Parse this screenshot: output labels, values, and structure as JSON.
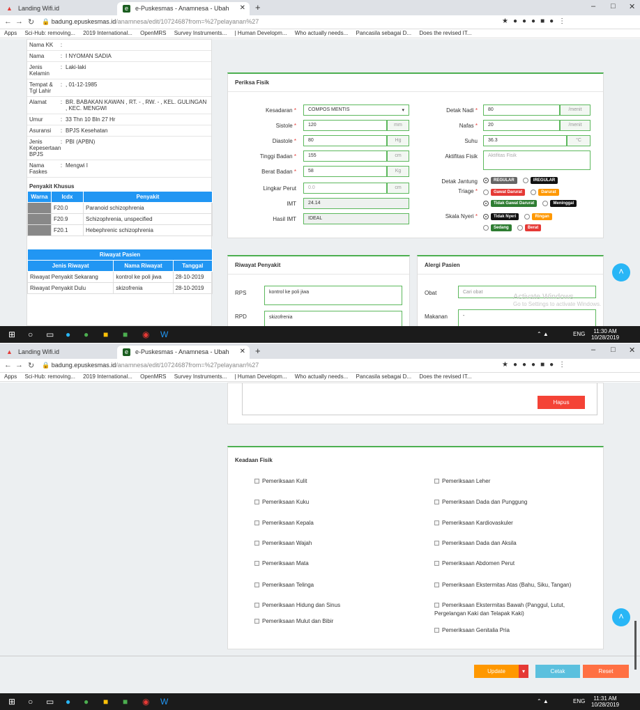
{
  "browser": {
    "tab1": "Landing Wifi.id",
    "tab2": "e-Puskesmas - Anamnesa - Ubah",
    "url_host": "badung.epuskesmas.id",
    "url_path": "/anamnesa/edit/10724687from=%27pelayanan%27",
    "bookmarks": [
      "Apps",
      "Sci-Hub: removing...",
      "2019 International...",
      "OpenMRS",
      "Survey Instruments...",
      "| Human Developm...",
      "Who actually needs...",
      "Pancasila sebagai D...",
      "Does the revised IT..."
    ]
  },
  "patient": {
    "rows": [
      {
        "k": "Nama KK",
        "v": ""
      },
      {
        "k": "Nama",
        "v": "I NYOMAN SADIA"
      },
      {
        "k": "Jenis Kelamin",
        "v": "Laki-laki"
      },
      {
        "k": "Tempat & Tgl Lahir",
        "v": ", 01-12-1985"
      },
      {
        "k": "Alamat",
        "v": "BR. BABAKAN KAWAN , RT. - , RW. - , KEL. GULINGAN , KEC. MENGWI"
      },
      {
        "k": "Umur",
        "v": "33 Thn 10 Bln 27 Hr"
      },
      {
        "k": "Asuransi",
        "v": "BPJS Kesehatan"
      },
      {
        "k": "Jenis Kepesertaan BPJS",
        "v": "PBI (APBN)"
      },
      {
        "k": "Nama Faskes",
        "v": "Mengwi I"
      }
    ],
    "khusus_title": "Penyakit Khusus",
    "khusus_headers": [
      "Warna",
      "Icdx",
      "Penyakit"
    ],
    "khusus_rows": [
      {
        "icdx": "F20.0",
        "penyakit": "Paranoid schizophrenia"
      },
      {
        "icdx": "F20.9",
        "penyakit": "Schizophrenia, unspecified"
      },
      {
        "icdx": "F20.1",
        "penyakit": "Hebephrenic schizophrenia"
      }
    ],
    "riwayat_title": "Riwayat Pasien",
    "riwayat_headers": [
      "Jenis Riwayat",
      "Nama Riwayat",
      "Tanggal"
    ],
    "riwayat_rows": [
      {
        "jenis": "Riwayat Penyakit Sekarang",
        "nama": "kontrol ke poli jiwa",
        "tanggal": "28-10-2019"
      },
      {
        "jenis": "Riwayat Penyakit Dulu",
        "nama": "skizofrenia",
        "tanggal": "28-10-2019"
      }
    ]
  },
  "periksa": {
    "title": "Periksa Fisik",
    "kesadaran_label": "Kesadaran",
    "kesadaran_value": "COMPOS MENTIS",
    "sistole_label": "Sistole",
    "sistole_value": "120",
    "sistole_unit": "mm",
    "diastole_label": "Diastole",
    "diastole_value": "80",
    "diastole_unit": "Hg",
    "tinggi_label": "Tinggi Badan",
    "tinggi_value": "155",
    "tinggi_unit": "cm",
    "berat_label": "Berat Badan",
    "berat_value": "58",
    "berat_unit": "Kg",
    "lingkar_label": "Lingkar Perut",
    "lingkar_placeholder": "0.0",
    "lingkar_unit": "cm",
    "imt_label": "IMT",
    "imt_value": "24.14",
    "hasil_label": "Hasil IMT",
    "hasil_value": "IDEAL",
    "nadi_label": "Detak Nadi",
    "nadi_value": "80",
    "nadi_unit": "/menit",
    "nafas_label": "Nafas",
    "nafas_value": "20",
    "nafas_unit": "/menit",
    "suhu_label": "Suhu",
    "suhu_value": "36.3",
    "suhu_unit": "°C",
    "aktifitas_label": "Aktifitas Fisik",
    "aktifitas_placeholder": "Aktifitas Fisik",
    "jantung_label": "Detak Jantung",
    "jantung_opts": [
      "REGULAR",
      "IREGULAR"
    ],
    "triage_label": "Triage",
    "triage_opts": [
      "Gawat Darurat",
      "Darurat",
      "Tidak Gawat Darurat",
      "Meninggal"
    ],
    "nyeri_label": "Skala Nyeri",
    "nyeri_opts": [
      "Tidak Nyeri",
      "Ringan",
      "Sedang",
      "Berat"
    ]
  },
  "riwayat_penyakit": {
    "title": "Riwayat Penyakit",
    "rps_label": "RPS",
    "rps_value": "kontrol ke poli jiwa",
    "rpd_label": "RPD",
    "rpd_value": "skizofrenia"
  },
  "alergi": {
    "title": "Alergi Pasien",
    "obat_label": "Obat",
    "obat_placeholder": "Cari obat",
    "makanan_label": "Makanan",
    "makanan_value": "-"
  },
  "windows_watermark": {
    "line1": "Activate Windows",
    "line2": "Go to Settings to activate Windows."
  },
  "taskbar": {
    "time1": "11:30 AM",
    "time2": "11:31 AM",
    "date": "10/28/2019",
    "lang": "ENG"
  },
  "hapus_label": "Hapus",
  "keadaan": {
    "title": "Keadaan Fisik",
    "left": [
      "Pemeriksaan Kulit",
      "Pemeriksaan Kuku",
      "Pemeriksaan Kepala",
      "Pemeriksaan Wajah",
      "Pemeriksaan Mata",
      "Pemeriksaan Telinga",
      "Pemeriksaan Hidung dan Sinus",
      "Pemeriksaan Mulut dan Bibir"
    ],
    "right": [
      "Pemeriksaan Leher",
      "Pemeriksaan Dada dan Punggung",
      "Pemeriksaan Kardiovaskuler",
      "Pemeriksaan Dada dan Aksila",
      "Pemeriksaan Abdomen Perut",
      "Pemeriksaan Ekstermitas Atas (Bahu, Siku, Tangan)",
      "Pemeriksaan Ekstermitas Bawah (Panggul, Lutut,",
      "Pergelangan Kaki dan Telapak Kaki)",
      "Pemeriksaan Genitalia Pria"
    ]
  },
  "actions": {
    "update": "Update",
    "cetak": "Cetak",
    "reset": "Reset"
  },
  "colors": {
    "accent": "#2196f3",
    "green": "#4caf50",
    "update": "#ff9800",
    "cetak": "#5bc0de",
    "reset": "#ff7043",
    "danger": "#e53935"
  }
}
